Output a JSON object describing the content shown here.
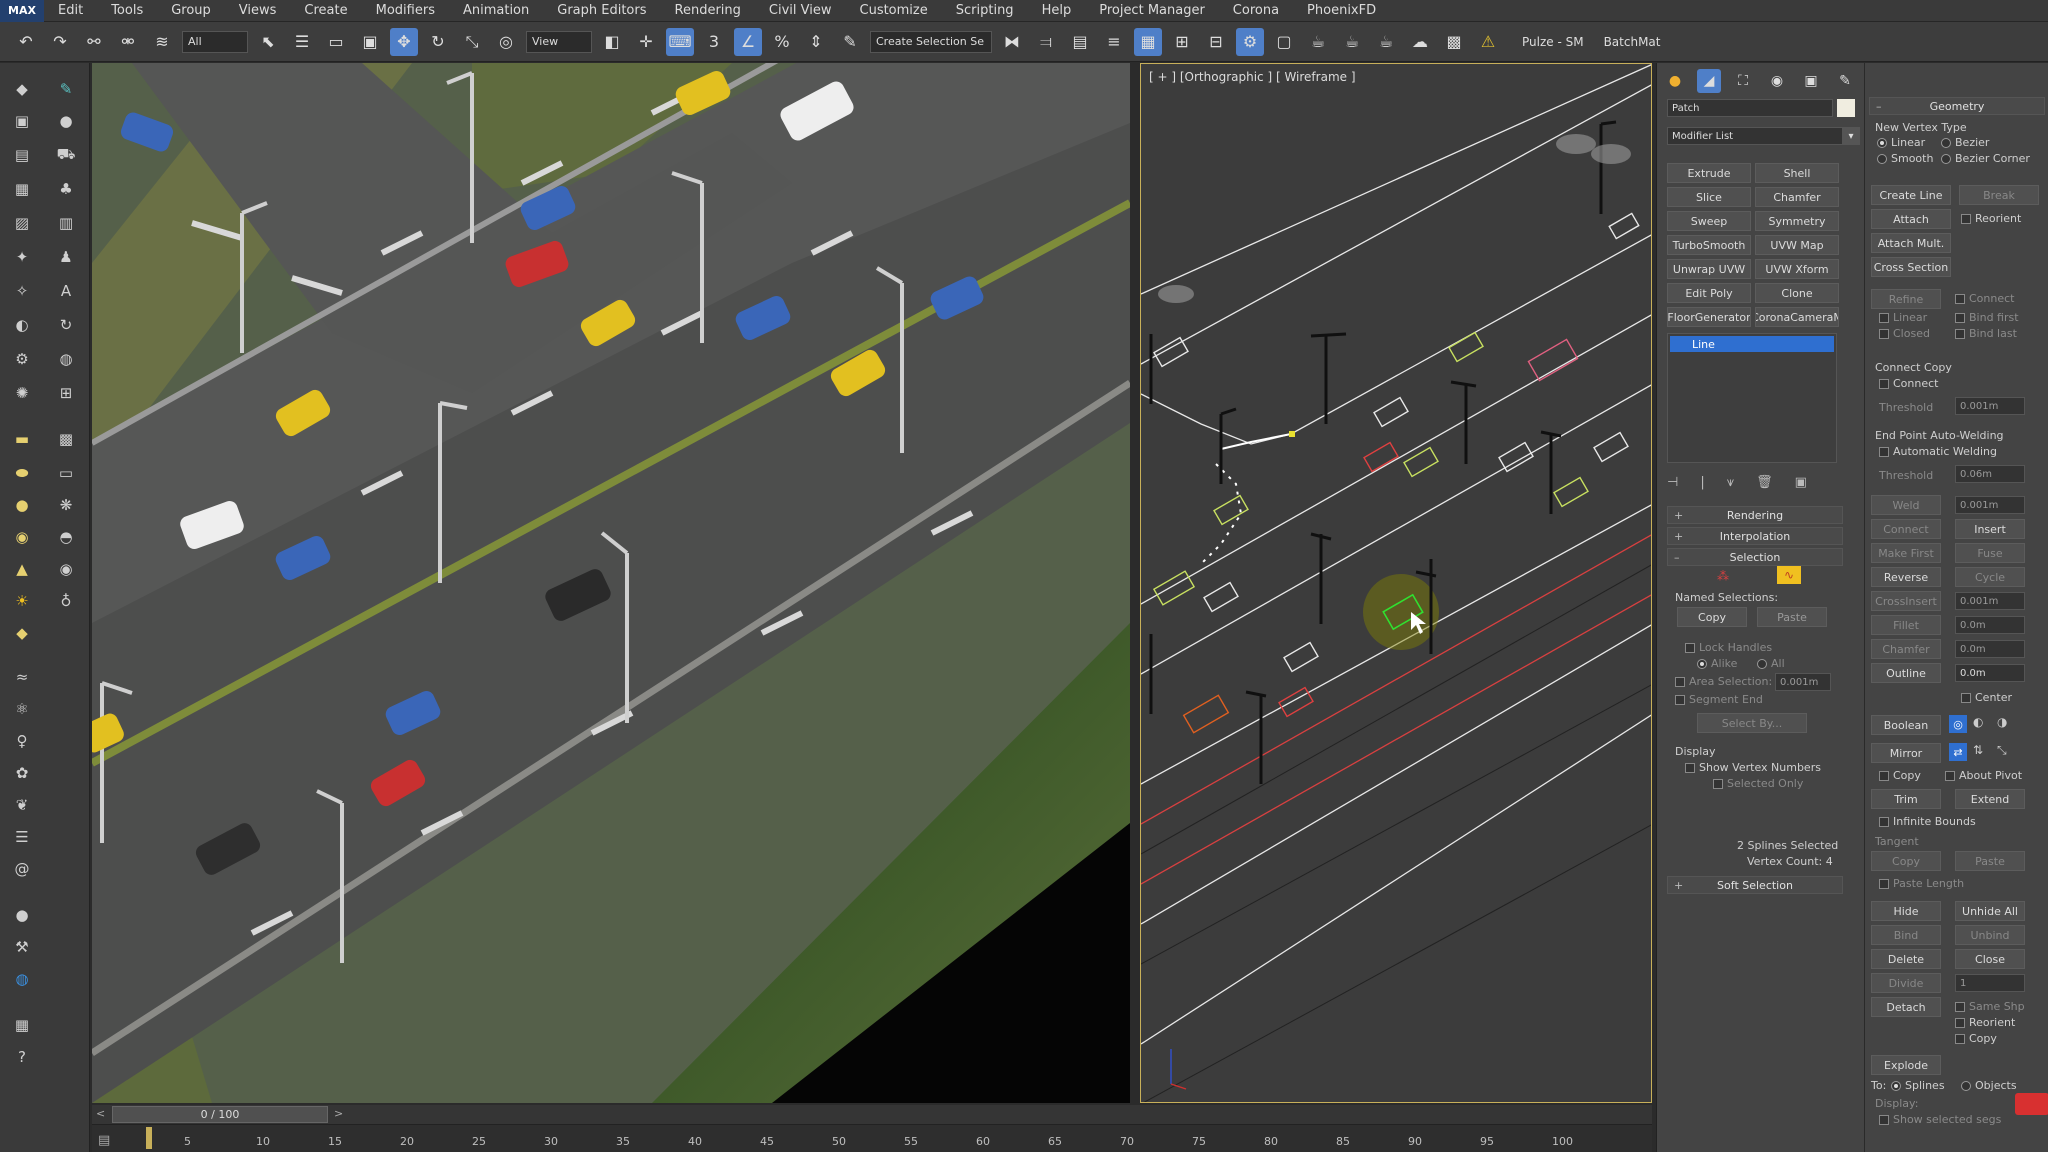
{
  "menu": {
    "logo": "MAX",
    "items": [
      "Edit",
      "Tools",
      "Group",
      "Views",
      "Create",
      "Modifiers",
      "Animation",
      "Graph Editors",
      "Rendering",
      "Civil View",
      "Customize",
      "Scripting",
      "Help",
      "Project Manager",
      "Corona",
      "PhoenixFD"
    ]
  },
  "toolbar": {
    "selection_filter": "All",
    "reference_coord": "View",
    "named_selection": "Create Selection Se",
    "plugin_label": "Pulze - SM",
    "batch_label": "BatchMat"
  },
  "viewport_right": {
    "label": "[ + ] [Orthographic ] [ Wireframe ]"
  },
  "command_panel": {
    "object_name": "Patch",
    "modifier_list": "Modifier List",
    "modifier_buttons": [
      [
        "Extrude",
        "Shell"
      ],
      [
        "Slice",
        "Chamfer"
      ],
      [
        "Sweep",
        "Symmetry"
      ],
      [
        "TurboSmooth",
        "UVW Map"
      ],
      [
        "Unwrap UVW",
        "UVW Xform"
      ],
      [
        "Edit Poly",
        "Clone"
      ],
      [
        "FloorGenerator",
        "CoronaCameraM"
      ]
    ],
    "stack_item": "Line",
    "rollouts": {
      "rendering": "Rendering",
      "interpolation": "Interpolation",
      "selection": "Selection",
      "soft_selection": "Soft Selection"
    },
    "selection": {
      "named_selections": "Named Selections:",
      "copy": "Copy",
      "paste": "Paste",
      "lock_handles": "Lock Handles",
      "alike": "Alike",
      "all": "All",
      "area_selection": "Area Selection:",
      "area_value": "0.001m",
      "segment_end": "Segment End",
      "select_by": "Select By...",
      "display": "Display",
      "show_vertex_numbers": "Show Vertex Numbers",
      "selected_only": "Selected Only",
      "status_1": "2 Splines Selected",
      "status_2": "Vertex Count: 4"
    }
  },
  "geometry": {
    "title": "Geometry",
    "new_vertex_type": "New Vertex Type",
    "linear": "Linear",
    "bezier": "Bezier",
    "smooth": "Smooth",
    "bezier_corner": "Bezier Corner",
    "create_line": "Create Line",
    "break": "Break",
    "attach": "Attach",
    "reorient": "Reorient",
    "attach_mult": "Attach Mult.",
    "cross_section": "Cross Section",
    "refine": "Refine",
    "connect": "Connect",
    "linear2": "Linear",
    "bind_first": "Bind first",
    "closed": "Closed",
    "bind_last": "Bind last",
    "connect_copy": "Connect Copy",
    "connect2": "Connect",
    "threshold": "Threshold",
    "threshold_val": "0.001m",
    "end_point_auto": "End Point Auto-Welding",
    "automatic_welding": "Automatic Welding",
    "threshold2": "Threshold",
    "threshold2_val": "0.06m",
    "weld": "Weld",
    "weld_val": "0.001m",
    "connect3": "Connect",
    "insert": "Insert",
    "make_first": "Make First",
    "fuse": "Fuse",
    "reverse": "Reverse",
    "cycle": "Cycle",
    "crossinsert": "CrossInsert",
    "crossinsert_val": "0.001m",
    "fillet": "Fillet",
    "fillet_val": "0.0m",
    "chamfer": "Chamfer",
    "chamfer_val": "0.0m",
    "outline": "Outline",
    "outline_val": "0.0m",
    "center": "Center",
    "boolean": "Boolean",
    "mirror": "Mirror",
    "copy": "Copy",
    "about_pivot": "About Pivot",
    "trim": "Trim",
    "extend": "Extend",
    "infinite_bounds": "Infinite Bounds",
    "tangent": "Tangent",
    "t_copy": "Copy",
    "t_paste": "Paste",
    "paste_length": "Paste Length",
    "hide": "Hide",
    "unhide_all": "Unhide All",
    "bind": "Bind",
    "unbind": "Unbind",
    "delete": "Delete",
    "close": "Close",
    "divide": "Divide",
    "divide_val": "1",
    "detach": "Detach",
    "same_shp": "Same Shp",
    "reorient2": "Reorient",
    "copy2": "Copy",
    "explode": "Explode",
    "to": "To:",
    "splines": "Splines",
    "objects": "Objects",
    "display": "Display:",
    "show_selected_segs": "Show selected segs"
  },
  "timeline": {
    "frame_display": "0 / 100",
    "ticks": [
      "5",
      "10",
      "15",
      "20",
      "25",
      "30",
      "35",
      "40",
      "45",
      "50",
      "55",
      "60",
      "65",
      "70",
      "75",
      "80",
      "85",
      "90",
      "95",
      "100"
    ]
  }
}
